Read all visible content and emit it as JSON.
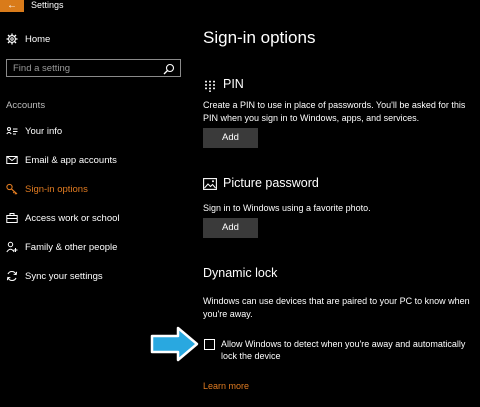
{
  "titlebar": {
    "back_glyph": "←",
    "title": "Settings"
  },
  "sidebar": {
    "home": "Home",
    "search_placeholder": "Find a setting",
    "section": "Accounts",
    "items": [
      {
        "label": "Your info",
        "icon": "person-card-icon"
      },
      {
        "label": "Email & app accounts",
        "icon": "mail-icon"
      },
      {
        "label": "Sign-in options",
        "icon": "key-icon",
        "active": true
      },
      {
        "label": "Access work or school",
        "icon": "briefcase-icon"
      },
      {
        "label": "Family & other people",
        "icon": "people-icon"
      },
      {
        "label": "Sync your settings",
        "icon": "sync-icon"
      }
    ]
  },
  "main": {
    "title": "Sign-in options",
    "pin": {
      "heading": "PIN",
      "description": "Create a PIN to use in place of passwords. You'll be asked for this PIN when you sign in to Windows, apps, and services.",
      "button": "Add"
    },
    "picture_password": {
      "heading": "Picture password",
      "description": "Sign in to Windows using a favorite photo.",
      "button": "Add"
    },
    "dynamic_lock": {
      "heading": "Dynamic lock",
      "description": "Windows can use devices that are paired to your PC to know when you're away.",
      "checkbox_label": "Allow Windows to detect when you're away and automatically lock the device",
      "checked": false,
      "link": "Learn more"
    }
  },
  "colors": {
    "accent": "#e07b21",
    "background": "#000000",
    "button": "#3a3a3a",
    "callout_arrow": "#29a8e0"
  }
}
